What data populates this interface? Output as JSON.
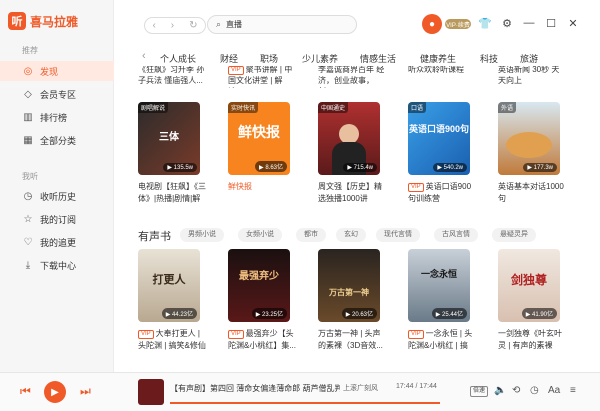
{
  "app": {
    "logo_mark": "听",
    "logo_text": "喜马拉雅"
  },
  "sidebar": {
    "section1": "推荐",
    "items1": [
      {
        "label": "发现",
        "icon": "discover-icon",
        "glyph": "◎"
      },
      {
        "label": "会员专区",
        "icon": "vip-icon",
        "glyph": "◇"
      },
      {
        "label": "排行榜",
        "icon": "chart-icon",
        "glyph": "▥"
      },
      {
        "label": "全部分类",
        "icon": "grid-icon",
        "glyph": "▦"
      }
    ],
    "section2": "我听",
    "items2": [
      {
        "label": "收听历史",
        "icon": "clock-icon",
        "glyph": "◷"
      },
      {
        "label": "我的订阅",
        "icon": "star-icon",
        "glyph": "☆"
      },
      {
        "label": "我的追更",
        "icon": "heart-icon",
        "glyph": "♡"
      },
      {
        "label": "下载中心",
        "icon": "download-icon",
        "glyph": "⤓"
      }
    ]
  },
  "topbar": {
    "search_value": "直播",
    "vip_label": "VIP·续费"
  },
  "categories": [
    "个人成长",
    "财经",
    "职场",
    "少儿素养",
    "情感生活",
    "健康养生",
    "科技",
    "旅游"
  ],
  "top_row": [
    {
      "badge": "",
      "text": "《狂飙》习升季 孙子兵法 懂庙强人..."
    },
    {
      "badge": "VIP",
      "text": "聚书讲解 | 中国文化讲堂 | 解读..."
    },
    {
      "badge": "",
      "text": "李嘉诚商界百年 经济，创业故事，创..."
    },
    {
      "badge": "",
      "text": "听众欢聆听课程"
    },
    {
      "badge": "",
      "text": "英语新闻 30秒 天天向上"
    }
  ],
  "row1": [
    {
      "tag": "剧唱解说",
      "art": "三体",
      "count": "135.5w",
      "badge": "",
      "title": "电视剧【狂飙】《三体》|热播|剧情|解读"
    },
    {
      "tag": "实时快讯",
      "art": "鲜快报",
      "count": "8.63亿",
      "badge": "",
      "title": "鲜快报"
    },
    {
      "tag": "中国通史",
      "art": "",
      "count": "715.4w",
      "badge": "",
      "title": "周文强【历史】精选独播1000讲"
    },
    {
      "tag": "口语",
      "art": "英语口语900句",
      "count": "540.2w",
      "badge": "VIP",
      "title": "英语口语900句训练营"
    },
    {
      "tag": "外语",
      "art": "",
      "count": "177.3w",
      "badge": "",
      "title": "英语基本对话1000句"
    }
  ],
  "audio_books": {
    "title": "有声书",
    "pills": [
      "男频小说",
      "女频小说",
      "都市",
      "玄幻",
      "现代言情",
      "古风言情",
      "悬疑灵异"
    ]
  },
  "row2": [
    {
      "art": "打更人",
      "count": "44.23亿",
      "badge": "VIP",
      "title": "大奉打更人 | 头陀渊 | 搞笑&修仙VI..."
    },
    {
      "art": "最强弃少",
      "count": "23.25亿",
      "badge": "VIP",
      "title": "最强弃少【头陀渊&小桃红】集..."
    },
    {
      "art": "万古第一神",
      "count": "20.63亿",
      "badge": "",
      "title": "万古第一神 | 头声的素裸（3D音效..."
    },
    {
      "art": "一念永恒",
      "count": "25.44亿",
      "badge": "VIP",
      "title": "一念永恒 | 头陀渊&小桃红 | 搞笑..."
    },
    {
      "art": "剑独尊",
      "count": "41.90亿",
      "badge": "",
      "title": "一剑独尊《叶玄叶灵 | 有声的素裸（..."
    }
  ],
  "player": {
    "title": "【有声剧】第四回 薄命女偏逢薄命郎 葫芦僧乱判葫芦案",
    "next_label": "上滚广刻风",
    "time": "17:44 / 17:44",
    "progress": 1.0,
    "speed_label": "倍速"
  },
  "colors": {
    "accent": "#f05a28"
  }
}
